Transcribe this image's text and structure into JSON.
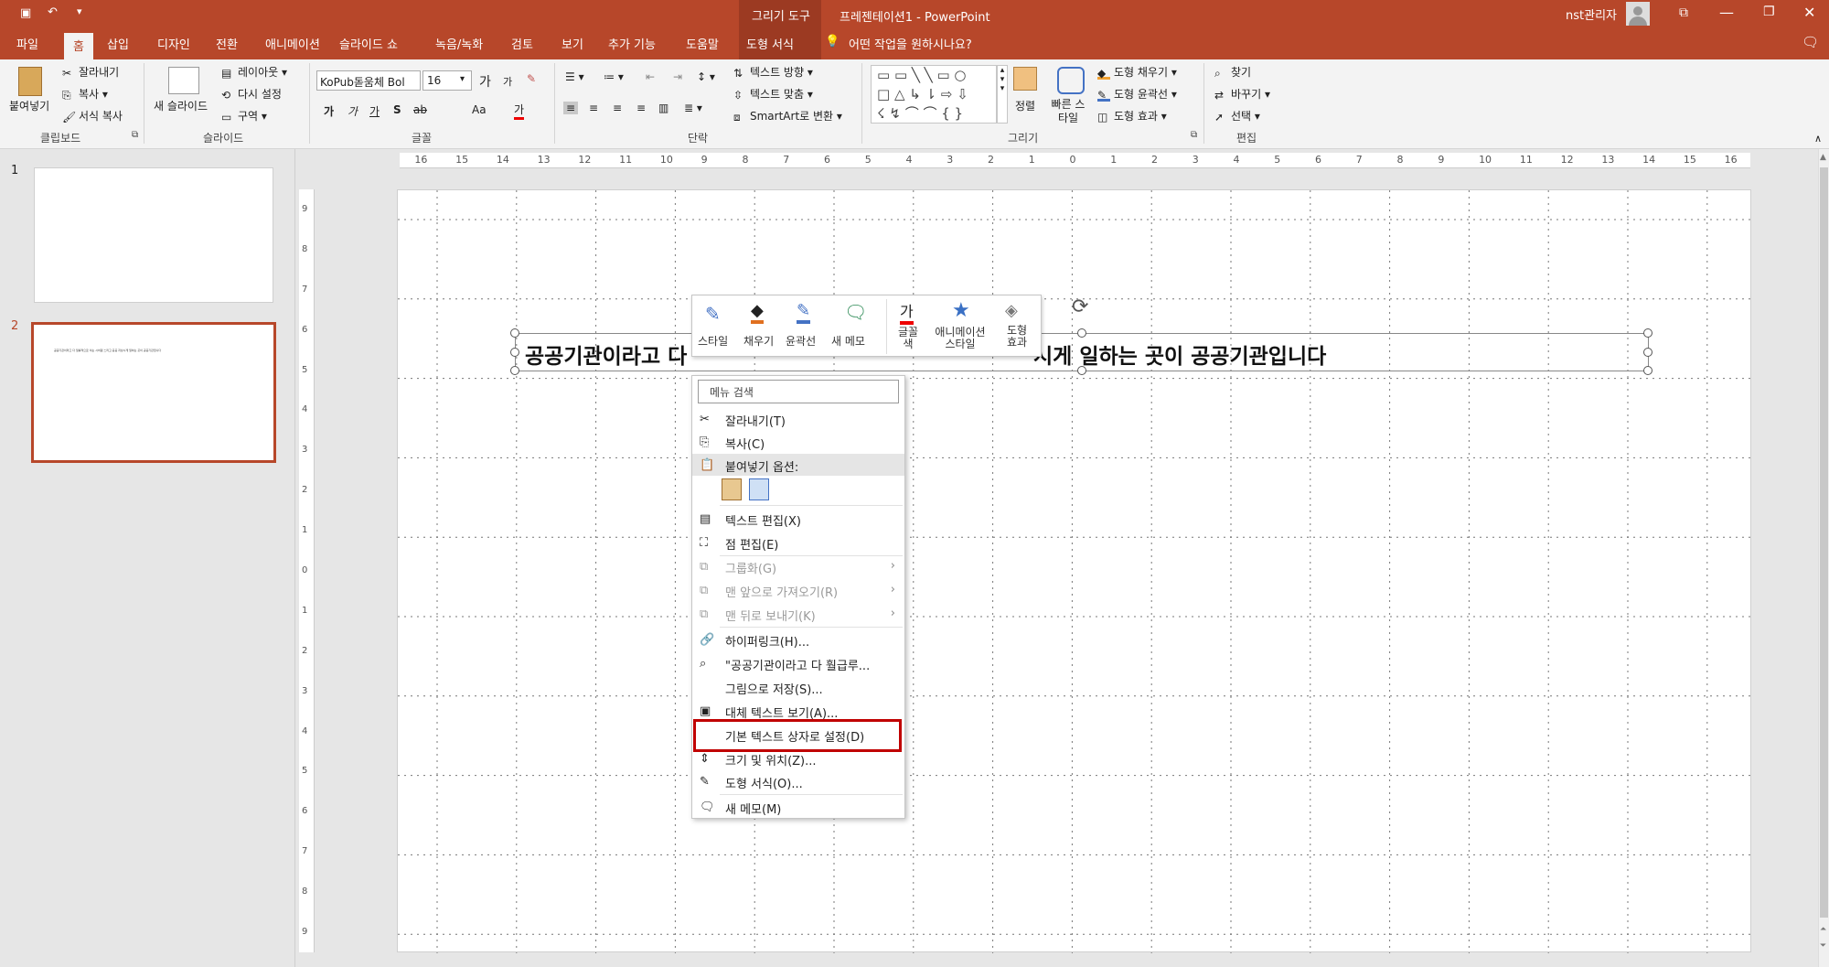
{
  "titlebar": {
    "contextual_tab": "그리기 도구",
    "doc_title": "프레젠테이션1  -  PowerPoint",
    "user": "nst관리자",
    "bg_color": "#b7472a"
  },
  "tabs": [
    "파일",
    "홈",
    "삽입",
    "디자인",
    "전환",
    "애니메이션",
    "슬라이드 쇼",
    "녹음/녹화",
    "검토",
    "보기",
    "추가 기능",
    "도움말",
    "도형 서식"
  ],
  "tell_me": "어떤 작업을 원하시나요?",
  "ribbon": {
    "clipboard": {
      "paste": "붙여넣기",
      "cut": "잘라내기",
      "copy": "복사",
      "format_painter": "서식 복사",
      "group": "클립보드"
    },
    "slides": {
      "new_slide": "새 슬라이드",
      "layout": "레이아웃",
      "reset": "다시 설정",
      "section": "구역",
      "group": "슬라이드"
    },
    "font": {
      "font_name": "KoPub돋움체 Bol",
      "font_size": "16",
      "group": "글꼴",
      "grow": "가",
      "shrink": "가",
      "bold": "가",
      "italic": "가",
      "underline": "가",
      "strike": "S",
      "spacing": "ab",
      "case": "Aa",
      "color": "가"
    },
    "paragraph": {
      "text_direction": "텍스트 방향",
      "align_text": "텍스트 맞춤",
      "smartart": "SmartArt로 변환",
      "group": "단락"
    },
    "drawing": {
      "arrange": "정렬",
      "quick_styles": "빠른 스타일",
      "fill": "도형 채우기",
      "outline": "도형 윤곽선",
      "effects": "도형 효과",
      "group": "그리기"
    },
    "editing": {
      "find": "찾기",
      "replace": "바꾸기",
      "select": "선택",
      "group": "편집"
    }
  },
  "slides_pane": {
    "items": [
      "1",
      "2"
    ],
    "thumb2_text": "공공기관이라고 다 일률적으로 이는 시처럼 느리고 공공 지상시게 일하는 곳이 공공기관입니다"
  },
  "slide": {
    "text_left": "공공기관이라고 다",
    "text_right": "시게 일하는 곳이 공공기관입니다"
  },
  "mini_toolbar": {
    "style": "스타일",
    "fill": "채우기",
    "outline": "윤곽선",
    "new_comment": "새 메모",
    "font_color": "글꼴 색",
    "animation": "애니메이션 스타일",
    "shape_effects": "도형 효과"
  },
  "context_menu": {
    "search_placeholder": "메뉴 검색",
    "cut": "잘라내기(T)",
    "copy": "복사(C)",
    "paste_options": "붙여넣기 옵션:",
    "edit_text": "텍스트 편집(X)",
    "edit_points": "점 편집(E)",
    "group": "그룹화(G)",
    "bring_front": "맨 앞으로 가져오기(R)",
    "send_back": "맨 뒤로 보내기(K)",
    "hyperlink": "하이퍼링크(H)...",
    "smart_lookup": "\"공공기관이라고 다 훨급루...",
    "save_picture": "그림으로 저장(S)...",
    "alt_text": "대체 텍스트 보기(A)...",
    "set_default": "기본 텍스트 상자로 설정(D)",
    "size_pos": "크기 및 위치(Z)...",
    "format_shape": "도형 서식(O)...",
    "new_comment": "새 메모(M)"
  },
  "ruler": {
    "h_ticks": [
      "16",
      "15",
      "14",
      "13",
      "12",
      "11",
      "10",
      "9",
      "8",
      "7",
      "6",
      "5",
      "4",
      "3",
      "2",
      "1",
      "0",
      "1",
      "2",
      "3",
      "4",
      "5",
      "6",
      "7",
      "8",
      "9",
      "10",
      "11",
      "12",
      "13",
      "14",
      "15",
      "16"
    ],
    "v_ticks": [
      "9",
      "8",
      "7",
      "6",
      "5",
      "4",
      "3",
      "2",
      "1",
      "0",
      "1",
      "2",
      "3",
      "4",
      "5",
      "6",
      "7",
      "8",
      "9"
    ]
  },
  "colors": {
    "accent": "#b7472a",
    "highlight_box": "#c00000"
  }
}
